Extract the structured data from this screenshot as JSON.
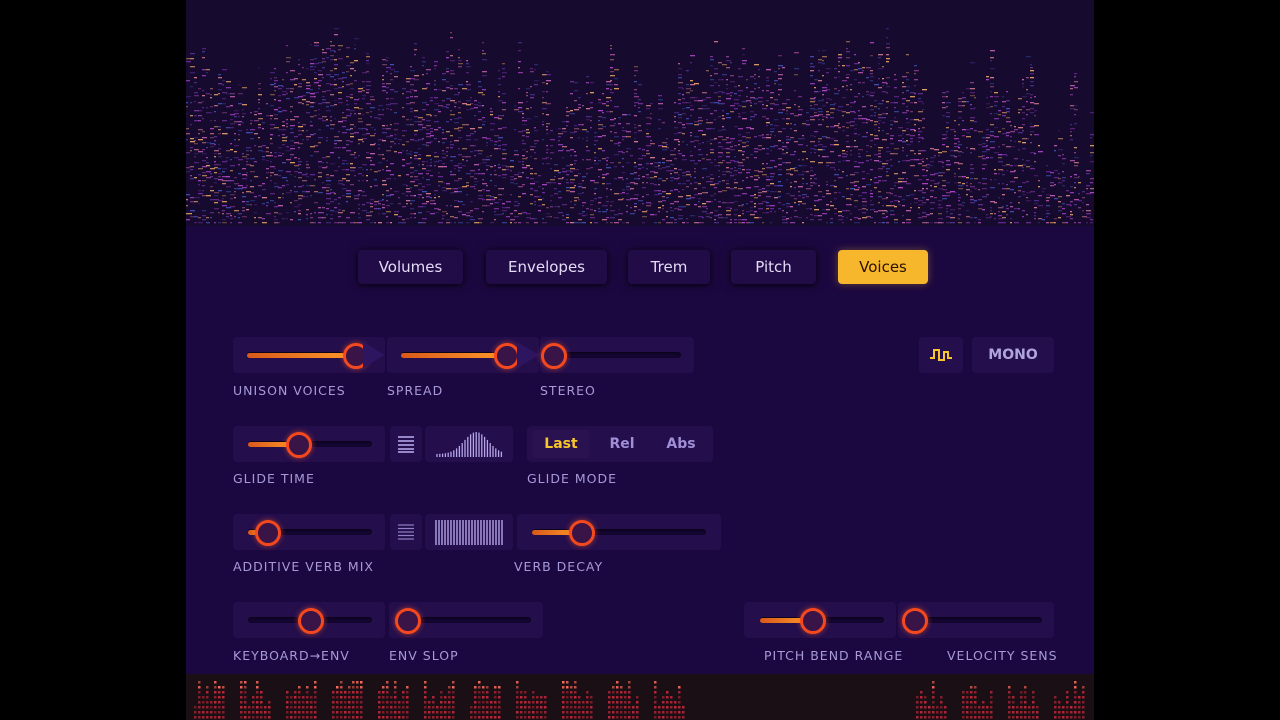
{
  "tabs": [
    {
      "label": "Volumes",
      "active": false
    },
    {
      "label": "Envelopes",
      "active": false
    },
    {
      "label": "Trem",
      "active": false
    },
    {
      "label": "Pitch",
      "active": false
    },
    {
      "label": "Voices",
      "active": true
    }
  ],
  "controls": {
    "unison_voices": {
      "label": "UNISON VOICES",
      "value": 0.87
    },
    "spread": {
      "label": "SPREAD",
      "value": 0.85
    },
    "stereo": {
      "label": "STEREO",
      "value": 0.0
    },
    "glide_time": {
      "label": "GLIDE TIME",
      "value": 0.4
    },
    "glide_mode": {
      "label": "GLIDE MODE",
      "options": [
        "Last",
        "Rel",
        "Abs"
      ],
      "selected": "Last"
    },
    "additive_verb_mix": {
      "label": "ADDITIVE VERB MIX",
      "value": 0.15
    },
    "verb_decay": {
      "label": "VERB DECAY",
      "value": 0.28
    },
    "keyboard_env": {
      "label": "KEYBOARD→ENV",
      "value": 0.5
    },
    "env_slop": {
      "label": "ENV SLOP",
      "value": 0.0
    },
    "pitch_bend_range": {
      "label": "PITCH BEND RANGE",
      "value": 0.42
    },
    "velocity_sens": {
      "label": "VELOCITY SENS",
      "value": 0.0
    }
  },
  "mono_button": {
    "label": "MONO",
    "icon": "legato-step-icon"
  },
  "icons": {
    "list": "list-lines-icon",
    "glide_curve": "bell-curve-bars-icon",
    "verb_bars": "uniform-bars-icon"
  },
  "colors": {
    "background": "#1c0840",
    "panel": "#240e4c",
    "accent": "#f6b72d",
    "slider_fill": "#ff8a22",
    "knob_ring": "#f4481f",
    "label": "#a79ad8"
  }
}
